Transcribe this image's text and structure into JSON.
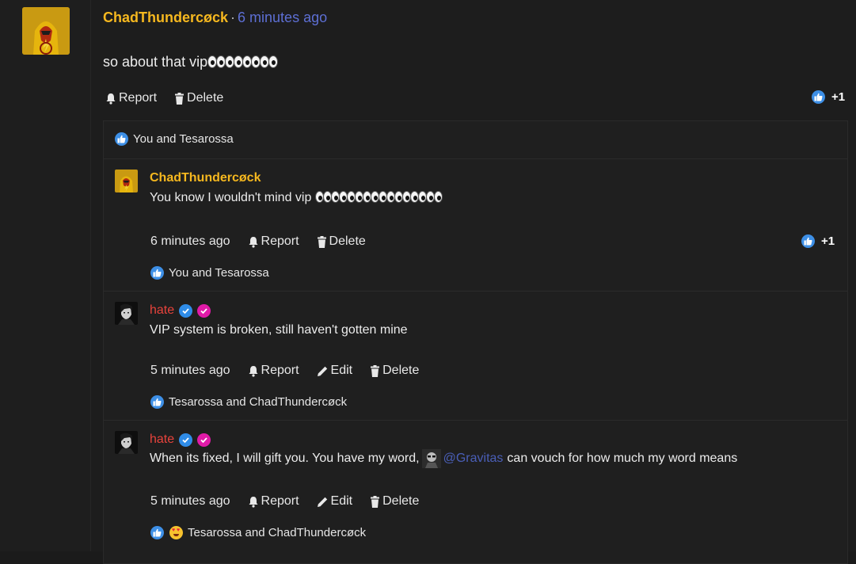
{
  "post": {
    "author": "ChadThundercøck",
    "separator": "·",
    "time": "6 minutes ago",
    "body": "so about that vip",
    "body_eyes": 8,
    "actions": {
      "report": "Report",
      "delete": "Delete"
    },
    "like_count": "+1",
    "reactions_text": "You and Tesarossa"
  },
  "comments": [
    {
      "author": "ChadThundercøck",
      "text": "You know I wouldn't mind vip",
      "eyes": 16,
      "time": "6 minutes ago",
      "actions": {
        "report": "Report",
        "delete": "Delete"
      },
      "like_count": "+1",
      "reactions_text": "You and Tesarossa"
    },
    {
      "author": "hate",
      "text": "VIP system is broken, still haven't gotten mine",
      "time": "5 minutes ago",
      "actions": {
        "report": "Report",
        "edit": "Edit",
        "delete": "Delete"
      },
      "reactions_text": "Tesarossa and ChadThundercøck"
    },
    {
      "author": "hate",
      "text_before": "When its fixed, I will gift you. You have my word,",
      "mention": "@Gravitas",
      "text_after": "can vouch for how much my word means",
      "time": "5 minutes ago",
      "actions": {
        "report": "Report",
        "edit": "Edit",
        "delete": "Delete"
      },
      "reactions_text": "Tesarossa and ChadThundercøck"
    }
  ],
  "colors": {
    "username_gold": "#f6b81f",
    "username_red": "#e8433c",
    "time_blue": "#5d6fd4",
    "like_blue": "#3d8fe6",
    "verified_blue": "#2f8ce8",
    "verified_pink": "#e01aa8"
  },
  "icons": {
    "report": "bell-icon",
    "delete": "trash-icon",
    "edit": "pencil-icon",
    "like": "thumbs-up-icon",
    "love": "heart-eyes-icon",
    "verified": "verified-badge-icon"
  }
}
